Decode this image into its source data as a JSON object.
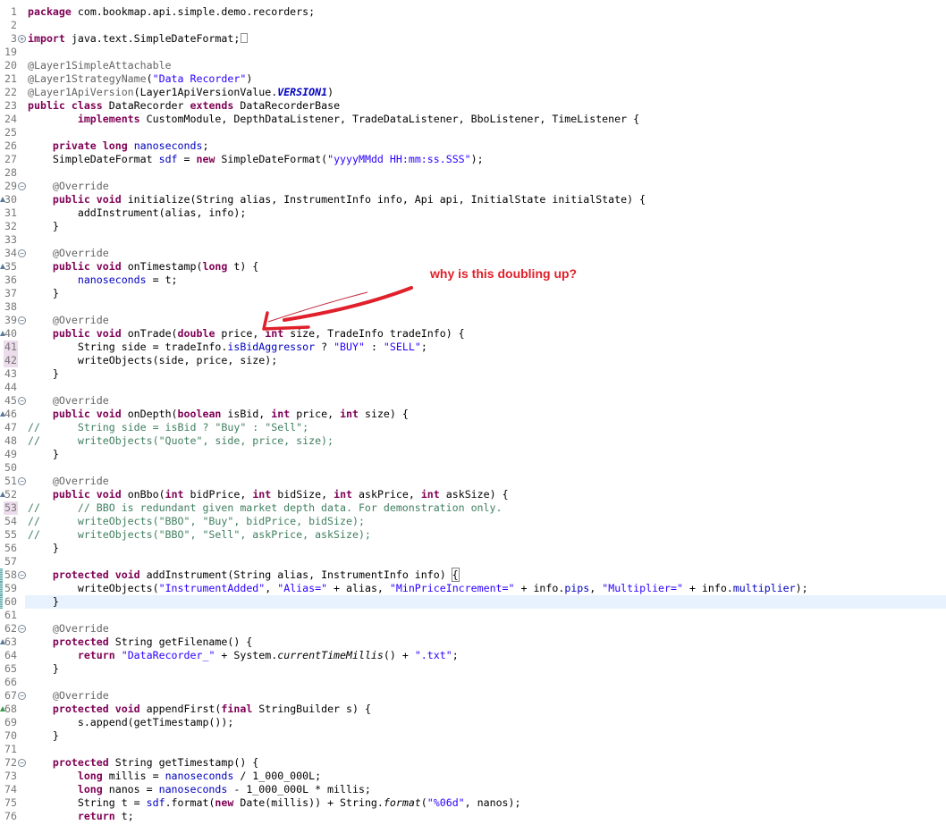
{
  "editor": {
    "current_line": 60,
    "lines": [
      {
        "n": "1",
        "tokens": [
          [
            "k",
            "package"
          ],
          [
            "p",
            " com.bookmap.api.simple.demo.recorders;"
          ]
        ]
      },
      {
        "n": "2",
        "tokens": []
      },
      {
        "n": "3",
        "fold": "expand",
        "tokens": [
          [
            "k",
            "import"
          ],
          [
            "p",
            " java.text.SimpleDateFormat;"
          ],
          [
            "box",
            ""
          ]
        ]
      },
      {
        "n": "19",
        "tokens": []
      },
      {
        "n": "20",
        "tokens": [
          [
            "a",
            "@Layer1SimpleAttachable"
          ]
        ]
      },
      {
        "n": "21",
        "tokens": [
          [
            "a",
            "@Layer1StrategyName"
          ],
          [
            "p",
            "("
          ],
          [
            "s",
            "\"Data Recorder\""
          ],
          [
            "p",
            ")"
          ]
        ]
      },
      {
        "n": "22",
        "tokens": [
          [
            "a",
            "@Layer1ApiVersion"
          ],
          [
            "p",
            "(Layer1ApiVersionValue."
          ],
          [
            "fi",
            "VERSION1"
          ],
          [
            "p",
            ")"
          ]
        ]
      },
      {
        "n": "23",
        "tokens": [
          [
            "k",
            "public"
          ],
          [
            "p",
            " "
          ],
          [
            "k",
            "class"
          ],
          [
            "p",
            " DataRecorder "
          ],
          [
            "k",
            "extends"
          ],
          [
            "p",
            " DataRecorderBase"
          ]
        ]
      },
      {
        "n": "24",
        "tokens": [
          [
            "p",
            "        "
          ],
          [
            "k",
            "implements"
          ],
          [
            "p",
            " CustomModule, DepthDataListener, TradeDataListener, BboListener, TimeListener {"
          ]
        ]
      },
      {
        "n": "25",
        "tokens": []
      },
      {
        "n": "26",
        "tokens": [
          [
            "p",
            "    "
          ],
          [
            "k",
            "private"
          ],
          [
            "p",
            " "
          ],
          [
            "k",
            "long"
          ],
          [
            "p",
            " "
          ],
          [
            "f",
            "nanoseconds"
          ],
          [
            "p",
            ";"
          ]
        ]
      },
      {
        "n": "27",
        "tokens": [
          [
            "p",
            "    SimpleDateFormat "
          ],
          [
            "f",
            "sdf"
          ],
          [
            "p",
            " = "
          ],
          [
            "k",
            "new"
          ],
          [
            "p",
            " SimpleDateFormat("
          ],
          [
            "s",
            "\"yyyyMMdd HH:mm:ss.SSS\""
          ],
          [
            "p",
            ");"
          ]
        ]
      },
      {
        "n": "28",
        "tokens": []
      },
      {
        "n": "29",
        "fold": "collapse",
        "tokens": [
          [
            "p",
            "    "
          ],
          [
            "a",
            "@Override"
          ]
        ]
      },
      {
        "n": "30",
        "override": true,
        "tokens": [
          [
            "p",
            "    "
          ],
          [
            "k",
            "public"
          ],
          [
            "p",
            " "
          ],
          [
            "k",
            "void"
          ],
          [
            "p",
            " initialize(String alias, InstrumentInfo info, Api api, InitialState initialState) {"
          ]
        ]
      },
      {
        "n": "31",
        "tokens": [
          [
            "p",
            "        addInstrument(alias, info);"
          ]
        ]
      },
      {
        "n": "32",
        "tokens": [
          [
            "p",
            "    }"
          ]
        ]
      },
      {
        "n": "33",
        "tokens": []
      },
      {
        "n": "34",
        "fold": "collapse",
        "tokens": [
          [
            "p",
            "    "
          ],
          [
            "a",
            "@Override"
          ]
        ]
      },
      {
        "n": "35",
        "override": true,
        "tokens": [
          [
            "p",
            "    "
          ],
          [
            "k",
            "public"
          ],
          [
            "p",
            " "
          ],
          [
            "k",
            "void"
          ],
          [
            "p",
            " onTimestamp("
          ],
          [
            "k",
            "long"
          ],
          [
            "p",
            " t) {"
          ]
        ]
      },
      {
        "n": "36",
        "tokens": [
          [
            "p",
            "        "
          ],
          [
            "f",
            "nanoseconds"
          ],
          [
            "p",
            " = t;"
          ]
        ]
      },
      {
        "n": "37",
        "tokens": [
          [
            "p",
            "    }"
          ]
        ]
      },
      {
        "n": "38",
        "tokens": []
      },
      {
        "n": "39",
        "fold": "collapse",
        "tokens": [
          [
            "p",
            "    "
          ],
          [
            "a",
            "@Override"
          ]
        ]
      },
      {
        "n": "40",
        "override": true,
        "tokens": [
          [
            "p",
            "    "
          ],
          [
            "k",
            "public"
          ],
          [
            "p",
            " "
          ],
          [
            "k",
            "void"
          ],
          [
            "p",
            " onTrade("
          ],
          [
            "k",
            "double"
          ],
          [
            "p",
            " price, "
          ],
          [
            "k",
            "int"
          ],
          [
            "p",
            " size, TradeInfo tradeInfo) {"
          ]
        ]
      },
      {
        "n": "41",
        "diff": true,
        "tokens": [
          [
            "p",
            "        String side = tradeInfo."
          ],
          [
            "f",
            "isBidAggressor"
          ],
          [
            "p",
            " ? "
          ],
          [
            "s",
            "\"BUY\""
          ],
          [
            "p",
            " : "
          ],
          [
            "s",
            "\"SELL\""
          ],
          [
            "p",
            ";"
          ]
        ]
      },
      {
        "n": "42",
        "diff": true,
        "tokens": [
          [
            "p",
            "        writeObjects(side, price, size);"
          ]
        ]
      },
      {
        "n": "43",
        "tokens": [
          [
            "p",
            "    }"
          ]
        ]
      },
      {
        "n": "44",
        "tokens": []
      },
      {
        "n": "45",
        "fold": "collapse",
        "tokens": [
          [
            "p",
            "    "
          ],
          [
            "a",
            "@Override"
          ]
        ]
      },
      {
        "n": "46",
        "override": true,
        "tokens": [
          [
            "p",
            "    "
          ],
          [
            "k",
            "public"
          ],
          [
            "p",
            " "
          ],
          [
            "k",
            "void"
          ],
          [
            "p",
            " onDepth("
          ],
          [
            "k",
            "boolean"
          ],
          [
            "p",
            " isBid, "
          ],
          [
            "k",
            "int"
          ],
          [
            "p",
            " price, "
          ],
          [
            "k",
            "int"
          ],
          [
            "p",
            " size) {"
          ]
        ]
      },
      {
        "n": "47",
        "tokens": [
          [
            "c",
            "//      String side = isBid ? \"Buy\" : \"Sell\";"
          ]
        ]
      },
      {
        "n": "48",
        "tokens": [
          [
            "c",
            "//      writeObjects(\"Quote\", side, price, size);"
          ]
        ]
      },
      {
        "n": "49",
        "tokens": [
          [
            "p",
            "    }"
          ]
        ]
      },
      {
        "n": "50",
        "tokens": []
      },
      {
        "n": "51",
        "fold": "collapse",
        "tokens": [
          [
            "p",
            "    "
          ],
          [
            "a",
            "@Override"
          ]
        ]
      },
      {
        "n": "52",
        "override": true,
        "tokens": [
          [
            "p",
            "    "
          ],
          [
            "k",
            "public"
          ],
          [
            "p",
            " "
          ],
          [
            "k",
            "void"
          ],
          [
            "p",
            " onBbo("
          ],
          [
            "k",
            "int"
          ],
          [
            "p",
            " bidPrice, "
          ],
          [
            "k",
            "int"
          ],
          [
            "p",
            " bidSize, "
          ],
          [
            "k",
            "int"
          ],
          [
            "p",
            " askPrice, "
          ],
          [
            "k",
            "int"
          ],
          [
            "p",
            " askSize) {"
          ]
        ]
      },
      {
        "n": "53",
        "diff": true,
        "tokens": [
          [
            "c",
            "//      // BBO is redundant given market depth data. For demonstration only."
          ]
        ]
      },
      {
        "n": "54",
        "tokens": [
          [
            "c",
            "//      writeObjects(\"BBO\", \"Buy\", bidPrice, bidSize);"
          ]
        ]
      },
      {
        "n": "55",
        "tokens": [
          [
            "c",
            "//      writeObjects(\"BBO\", \"Sell\", askPrice, askSize);"
          ]
        ]
      },
      {
        "n": "56",
        "tokens": [
          [
            "p",
            "    }"
          ]
        ]
      },
      {
        "n": "57",
        "tokens": []
      },
      {
        "n": "58",
        "fold": "collapse",
        "quick": true,
        "tokens": [
          [
            "p",
            "    "
          ],
          [
            "k",
            "protected"
          ],
          [
            "p",
            " "
          ],
          [
            "k",
            "void"
          ],
          [
            "p",
            " addInstrument(String alias, InstrumentInfo info) "
          ],
          [
            "bm",
            "{"
          ]
        ]
      },
      {
        "n": "59",
        "quick": true,
        "tokens": [
          [
            "p",
            "        writeObjects("
          ],
          [
            "s",
            "\"InstrumentAdded\""
          ],
          [
            "p",
            ", "
          ],
          [
            "s",
            "\"Alias=\""
          ],
          [
            "p",
            " + alias, "
          ],
          [
            "s",
            "\"MinPriceIncrement=\""
          ],
          [
            "p",
            " + info."
          ],
          [
            "f",
            "pips"
          ],
          [
            "p",
            ", "
          ],
          [
            "s",
            "\"Multiplier=\""
          ],
          [
            "p",
            " + info."
          ],
          [
            "f",
            "multiplier"
          ],
          [
            "p",
            ");"
          ]
        ]
      },
      {
        "n": "60",
        "quick": true,
        "tokens": [
          [
            "p",
            "    }"
          ]
        ]
      },
      {
        "n": "61",
        "tokens": []
      },
      {
        "n": "62",
        "fold": "collapse",
        "tokens": [
          [
            "p",
            "    "
          ],
          [
            "a",
            "@Override"
          ]
        ]
      },
      {
        "n": "63",
        "override": true,
        "tokens": [
          [
            "p",
            "    "
          ],
          [
            "k",
            "protected"
          ],
          [
            "p",
            " String getFilename() {"
          ]
        ]
      },
      {
        "n": "64",
        "tokens": [
          [
            "p",
            "        "
          ],
          [
            "k",
            "return"
          ],
          [
            "p",
            " "
          ],
          [
            "s",
            "\"DataRecorder_\""
          ],
          [
            "p",
            " + System."
          ],
          [
            "i",
            "currentTimeMillis"
          ],
          [
            "p",
            "() + "
          ],
          [
            "s",
            "\".txt\""
          ],
          [
            "p",
            ";"
          ]
        ]
      },
      {
        "n": "65",
        "tokens": [
          [
            "p",
            "    }"
          ]
        ]
      },
      {
        "n": "66",
        "tokens": []
      },
      {
        "n": "67",
        "fold": "collapse",
        "tokens": [
          [
            "p",
            "    "
          ],
          [
            "a",
            "@Override"
          ]
        ]
      },
      {
        "n": "68",
        "override": "green",
        "tokens": [
          [
            "p",
            "    "
          ],
          [
            "k",
            "protected"
          ],
          [
            "p",
            " "
          ],
          [
            "k",
            "void"
          ],
          [
            "p",
            " appendFirst("
          ],
          [
            "k",
            "final"
          ],
          [
            "p",
            " StringBuilder s) {"
          ]
        ]
      },
      {
        "n": "69",
        "tokens": [
          [
            "p",
            "        s.append(getTimestamp());"
          ]
        ]
      },
      {
        "n": "70",
        "tokens": [
          [
            "p",
            "    }"
          ]
        ]
      },
      {
        "n": "71",
        "tokens": []
      },
      {
        "n": "72",
        "fold": "collapse",
        "tokens": [
          [
            "p",
            "    "
          ],
          [
            "k",
            "protected"
          ],
          [
            "p",
            " String getTimestamp() {"
          ]
        ]
      },
      {
        "n": "73",
        "tokens": [
          [
            "p",
            "        "
          ],
          [
            "k",
            "long"
          ],
          [
            "p",
            " millis = "
          ],
          [
            "f",
            "nanoseconds"
          ],
          [
            "p",
            " / 1_000_000L;"
          ]
        ]
      },
      {
        "n": "74",
        "tokens": [
          [
            "p",
            "        "
          ],
          [
            "k",
            "long"
          ],
          [
            "p",
            " nanos = "
          ],
          [
            "f",
            "nanoseconds"
          ],
          [
            "p",
            " - 1_000_000L * millis;"
          ]
        ]
      },
      {
        "n": "75",
        "tokens": [
          [
            "p",
            "        String t = "
          ],
          [
            "f",
            "sdf"
          ],
          [
            "p",
            ".format("
          ],
          [
            "k",
            "new"
          ],
          [
            "p",
            " Date(millis)) + String."
          ],
          [
            "i",
            "format"
          ],
          [
            "p",
            "("
          ],
          [
            "s",
            "\"%06d\""
          ],
          [
            "p",
            ", nanos);"
          ]
        ]
      },
      {
        "n": "76",
        "tokens": [
          [
            "p",
            "        "
          ],
          [
            "k",
            "return"
          ],
          [
            "p",
            " t;"
          ]
        ]
      }
    ]
  },
  "annotation": {
    "note": "why is this doubling up?",
    "color": "#e0202a"
  }
}
